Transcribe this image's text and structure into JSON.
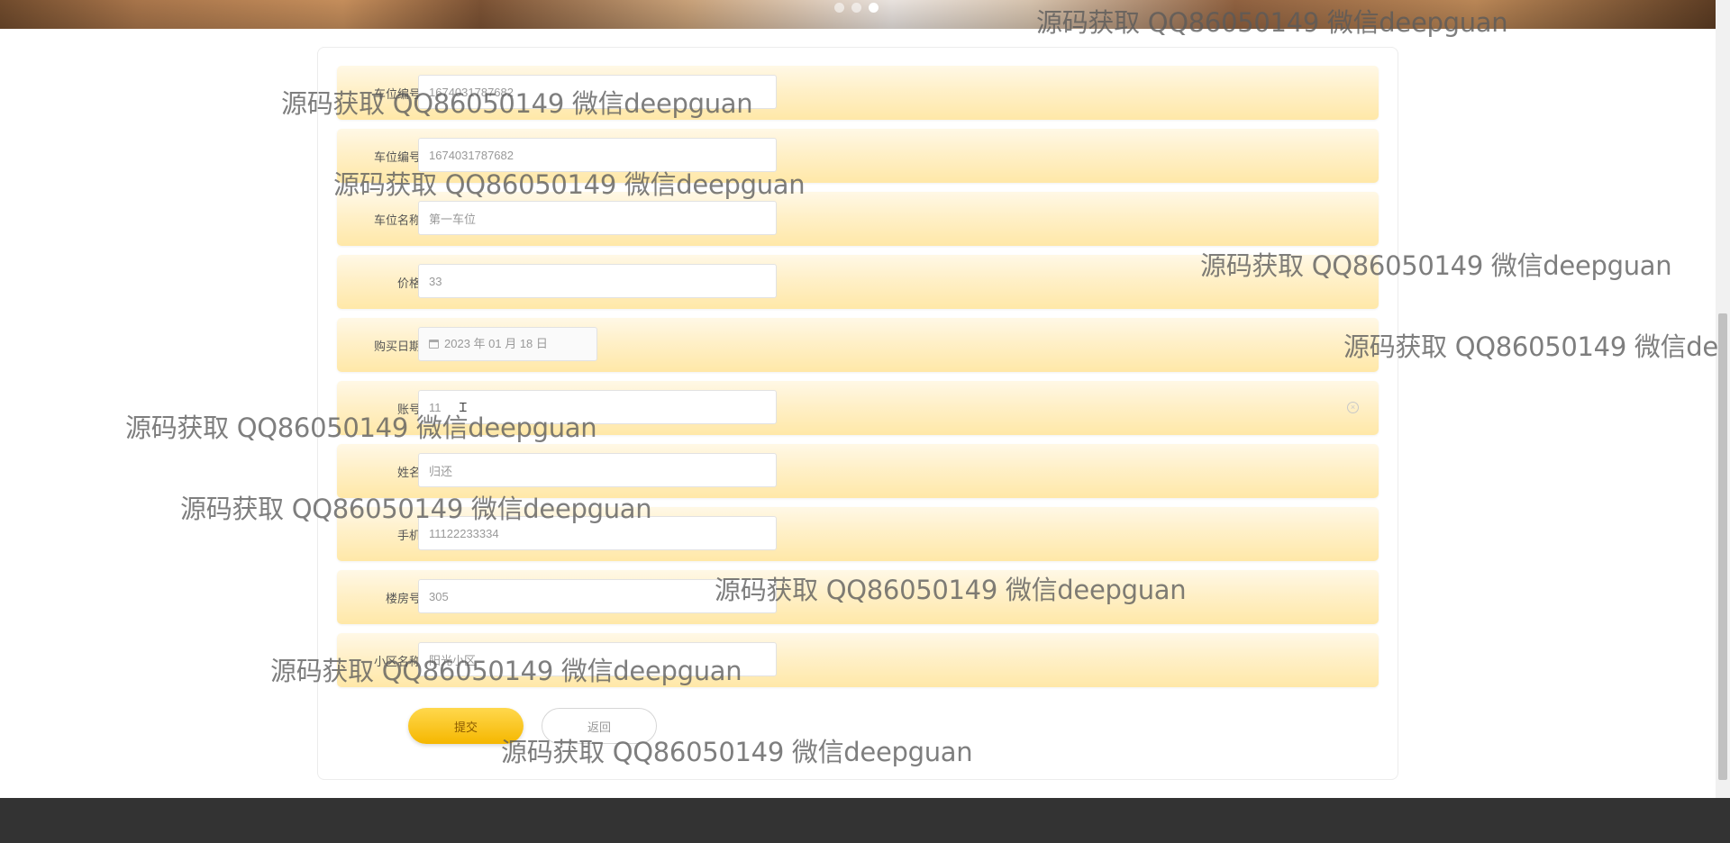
{
  "carousel": {
    "count": 3,
    "active_index": 2
  },
  "form": {
    "rows": [
      {
        "label": "车位编号",
        "value": "1674031787682",
        "obscured": true
      },
      {
        "label": "车位编号",
        "value": "1674031787682"
      },
      {
        "label": "车位名称",
        "value": "第一车位"
      },
      {
        "label": "价格",
        "value": "33"
      },
      {
        "label": "购买日期",
        "value": "2023 年 01 月 18 日"
      },
      {
        "label": "账号",
        "value": "11"
      },
      {
        "label": "姓名",
        "value": "归还"
      },
      {
        "label": "手机",
        "value": "11122233334"
      },
      {
        "label": "楼房号",
        "value": "305"
      },
      {
        "label": "小区名称",
        "value": "阳光小区"
      }
    ],
    "submit_label": "提交",
    "back_label": "返回"
  },
  "watermark": {
    "text": "源码获取 QQ86050149 微信deepguan",
    "text_cut": "源码获取 QQ86050149 微信de"
  },
  "colors": {
    "row_gradient_top": "#fff8e6",
    "row_gradient_bottom": "#ffe8a8",
    "submit_button": "#f5b700",
    "footer": "#333333"
  }
}
